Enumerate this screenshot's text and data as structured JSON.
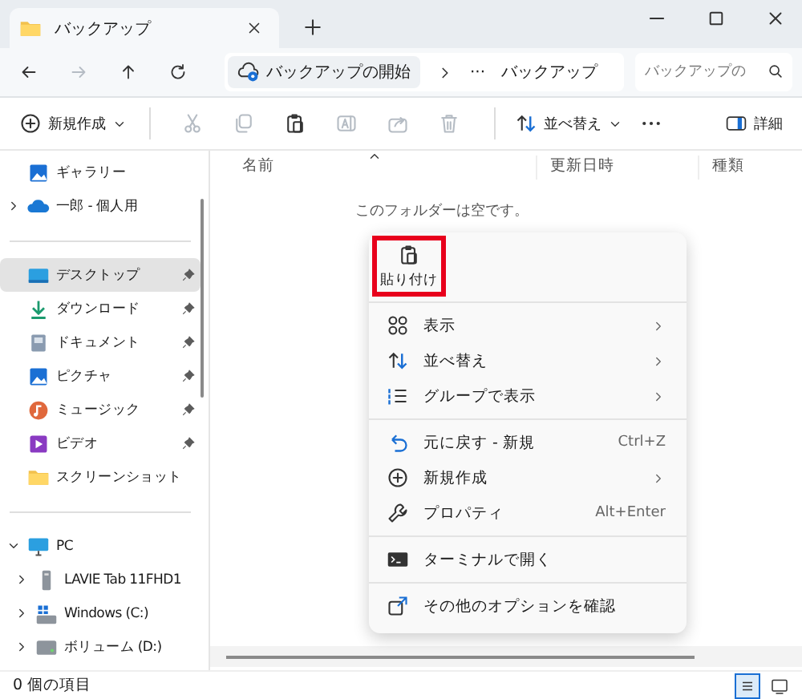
{
  "tabs": [
    {
      "title": "バックアップ",
      "selected": true
    }
  ],
  "nav": {
    "buttons": [
      {
        "disabled": false
      },
      {
        "disabled": true
      },
      {
        "disabled": false
      },
      {
        "disabled": false
      }
    ],
    "breadcrumb": [
      "バックアップの開始",
      "···",
      "バックアップ"
    ],
    "search": {
      "placeholder": "バックアップの"
    }
  },
  "command_bar": {
    "new": "新規作成",
    "tools": [
      {
        "disabled": true
      },
      {
        "disabled": true
      },
      {
        "disabled": false
      },
      {
        "disabled": true
      },
      {
        "disabled": true
      },
      {
        "disabled": true
      }
    ],
    "sort": "並べ替え",
    "details": "詳細"
  },
  "sidebar": {
    "sections": [
      [
        {
          "label": "ギャラリー",
          "selected": false
        },
        {
          "label": "一郎 - 個人用",
          "selected": false,
          "expanded": false
        }
      ],
      [
        {
          "label": "デスクトップ",
          "selected": true,
          "pinned": true
        },
        {
          "label": "ダウンロード",
          "selected": false,
          "pinned": true
        },
        {
          "label": "ドキュメント",
          "selected": false,
          "pinned": true
        },
        {
          "label": "ピクチャ",
          "selected": false,
          "pinned": true
        },
        {
          "label": "ミュージック",
          "selected": false,
          "pinned": true
        },
        {
          "label": "ビデオ",
          "selected": false,
          "pinned": true
        },
        {
          "label": "スクリーンショット",
          "selected": false,
          "pinned": false
        }
      ],
      [
        {
          "label": "PC",
          "selected": false,
          "expanded": true,
          "children": [
            {
              "label": "LAVIE Tab 11FHD1",
              "selected": false,
              "expanded": false
            },
            {
              "label": "Windows (C:)",
              "selected": false,
              "expanded": false
            },
            {
              "label": "ボリューム (D:)",
              "selected": false,
              "expanded": false
            }
          ]
        }
      ]
    ]
  },
  "columns": [
    {
      "label": "名前",
      "sorted": true
    },
    {
      "label": "更新日時",
      "sorted": false
    },
    {
      "label": "種類",
      "sorted": false
    }
  ],
  "empty_message": "このフォルダーは空です。",
  "context_menu": {
    "top_action": {
      "label": "貼り付け",
      "highlighted": true
    },
    "groups": [
      [
        {
          "label": "表示",
          "submenu": true
        },
        {
          "label": "並べ替え",
          "submenu": true
        },
        {
          "label": "グループで表示",
          "submenu": true
        }
      ],
      [
        {
          "label": "元に戻す - 新規",
          "shortcut": "Ctrl+Z",
          "submenu": false
        },
        {
          "label": "新規作成",
          "submenu": true
        },
        {
          "label": "プロパティ",
          "shortcut": "Alt+Enter",
          "submenu": false
        }
      ],
      [
        {
          "label": "ターミナルで開く",
          "submenu": false
        }
      ],
      [
        {
          "label": "その他のオプションを確認",
          "submenu": false
        }
      ]
    ]
  },
  "status_bar": {
    "text": "0 個の項目",
    "views": [
      {
        "selected": true
      },
      {
        "selected": false
      }
    ]
  }
}
